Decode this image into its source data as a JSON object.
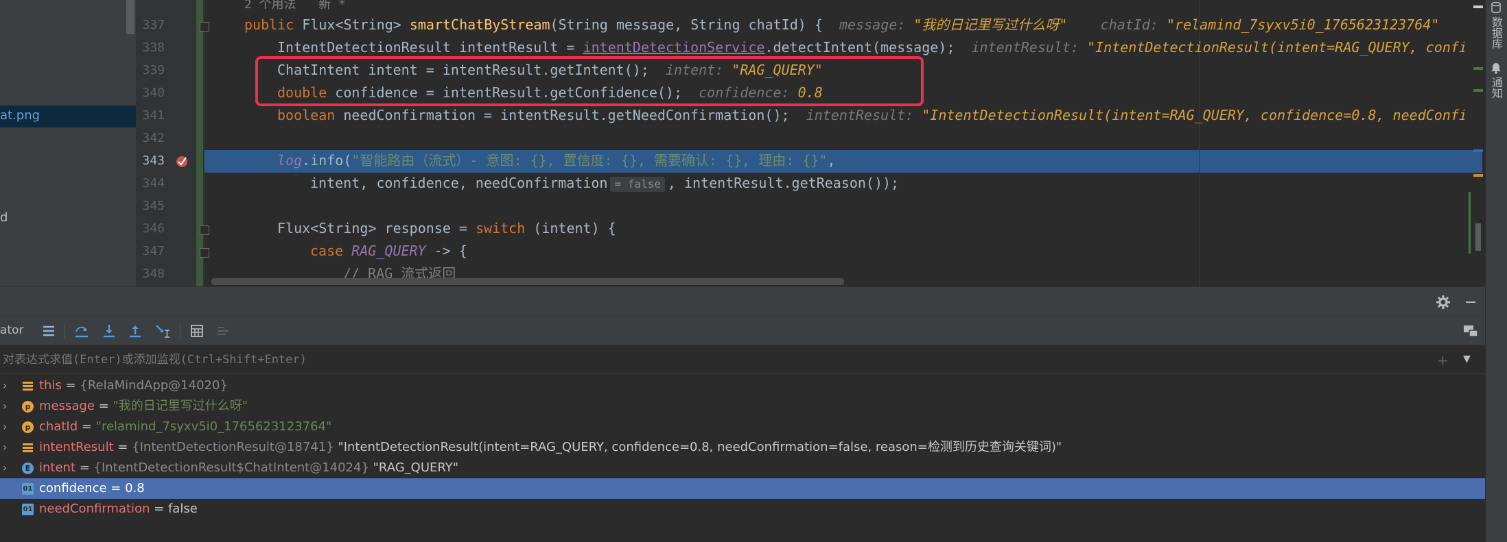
{
  "project": {
    "items": [
      {
        "label": "at.png",
        "selected": true
      },
      {
        "label": "d",
        "selected": false
      }
    ]
  },
  "editor": {
    "usage_hint": "2 个用法   新 *",
    "lines": [
      {
        "no": "337"
      },
      {
        "no": "338"
      },
      {
        "no": "339"
      },
      {
        "no": "340"
      },
      {
        "no": "341"
      },
      {
        "no": "342"
      },
      {
        "no": "343"
      },
      {
        "no": "344"
      },
      {
        "no": "345"
      },
      {
        "no": "346"
      },
      {
        "no": "347"
      },
      {
        "no": "348"
      }
    ],
    "l337": {
      "kw": "public",
      "type": "Flux<String>",
      "method": "smartChatByStream",
      "params_a": "(String message, String chatId) {",
      "h1_name": "message:",
      "h1_val": "\"我的日记里写过什么呀\"",
      "h2_name": "chatId:",
      "h2_val": "\"relamind_7syxv5i0_1765623123764\""
    },
    "l338": {
      "a": "IntentDetectionResult intentResult = ",
      "svc": "intentDetectionService",
      "b": ".detectIntent(message);",
      "h_name": "intentResult:",
      "h_val": "\"IntentDetectionResult(intent=RAG_QUERY, confide"
    },
    "l339": {
      "a": "ChatIntent intent = intentResult.getIntent();",
      "h_name": "intent:",
      "h_val": "\"RAG_QUERY\""
    },
    "l340": {
      "kw": "double",
      "a": " confidence = intentResult.getConfidence();",
      "h_name": "confidence:",
      "h_val": "0.8"
    },
    "l341": {
      "kw": "boolean",
      "a": " needConfirmation = intentResult.getNeedConfirmation();",
      "h_name": "intentResult:",
      "h_val": "\"IntentDetectionResult(intent=RAG_QUERY, confidence=0.8, needConfirm"
    },
    "l343": {
      "log": "log",
      "a": ".info(",
      "str": "\"智能路由（流式）- 意图: {}, 置信度: {}, 需要确认: {}, 理由: {}\"",
      "b": ","
    },
    "l344": {
      "a": "intent, confidence, needConfirmation",
      "badge": "= false",
      "b": ", intentResult.getReason());"
    },
    "l346": {
      "a": "Flux<String> response = ",
      "kw": "switch",
      "b": " (intent) {"
    },
    "l347": {
      "kw": "case",
      "en": "RAG_QUERY",
      "b": " -> {"
    },
    "l348": {
      "cm": "// RAG 流式返回"
    }
  },
  "right_strip": {
    "tab1": "数据库",
    "tab2": "通知"
  },
  "debug": {
    "frames_label": "ator",
    "eval_placeholder": "对表达式求值(Enter)或添加监视(Ctrl+Shift+Enter)",
    "vars": [
      {
        "icon": "field-icon",
        "icon_kind": "bars",
        "name": "this",
        "eq": " = ",
        "type": "{RelaMindApp@14020}",
        "value": "",
        "expandable": true
      },
      {
        "icon": "param-icon",
        "icon_kind": "p",
        "name": "message",
        "eq": " = ",
        "type": "",
        "value": "\"我的日记里写过什么呀\"",
        "value_kind": "str",
        "expandable": true
      },
      {
        "icon": "param-icon",
        "icon_kind": "p",
        "name": "chatId",
        "eq": " = ",
        "type": "",
        "value": "\"relamind_7syxv5i0_1765623123764\"",
        "value_kind": "str",
        "expandable": true
      },
      {
        "icon": "field-icon",
        "icon_kind": "bars",
        "name": "intentResult",
        "eq": " = ",
        "type": "{IntentDetectionResult@18741}",
        "value": " \"IntentDetectionResult(intent=RAG_QUERY, confidence=0.8, needConfirmation=false, reason=检测到历史查询关键词)\"",
        "value_kind": "text",
        "expandable": true
      },
      {
        "icon": "enum-icon",
        "icon_kind": "E",
        "name": "intent",
        "eq": " = ",
        "type": "{IntentDetectionResult$ChatIntent@14024}",
        "value": " \"RAG_QUERY\"",
        "value_kind": "text",
        "expandable": true
      },
      {
        "icon": "primitive-icon",
        "icon_kind": "01",
        "name": "confidence",
        "eq": " = ",
        "type": "",
        "value": "0.8",
        "value_kind": "text",
        "expandable": false,
        "selected": true
      },
      {
        "icon": "primitive-icon",
        "icon_kind": "01",
        "name": "needConfirmation",
        "eq": " = ",
        "type": "",
        "value": "false",
        "value_kind": "text",
        "expandable": false
      }
    ]
  },
  "colors": {
    "keyword": "#cc7832",
    "method": "#ffc66d",
    "string": "#6a8759",
    "highlight": "#2d5a8a",
    "selection": "#4b6eaf",
    "redbox": "#ef2f4e"
  }
}
